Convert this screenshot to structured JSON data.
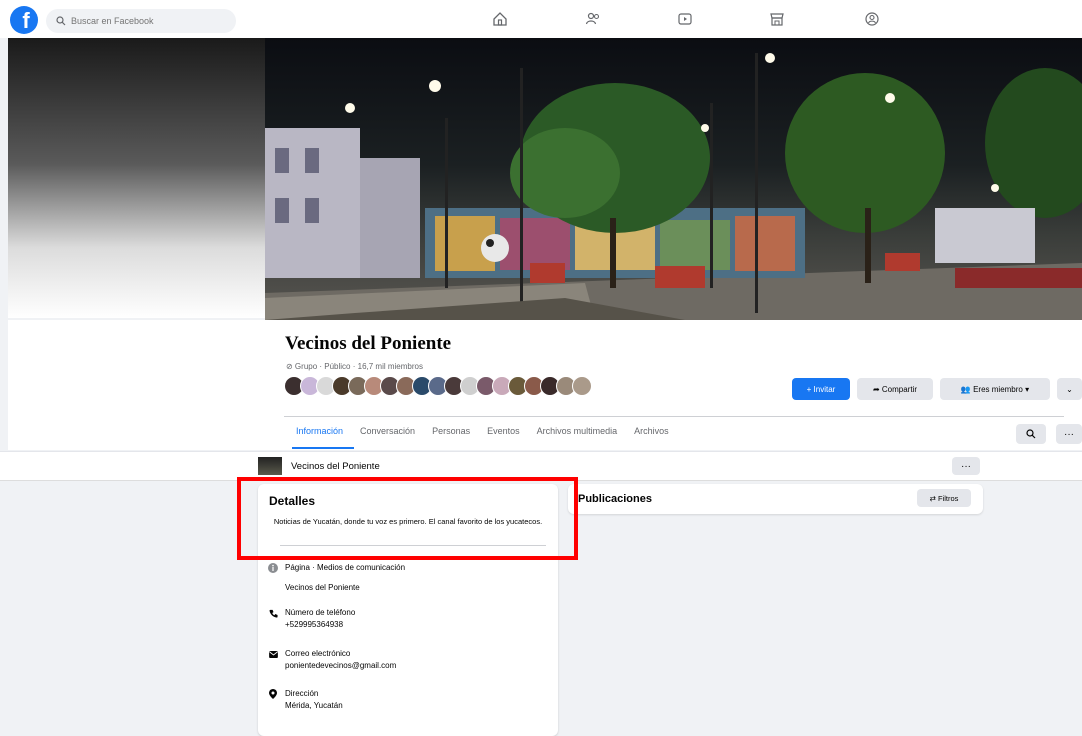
{
  "colors": {
    "brand": "#1877f2",
    "highlight": "#ff0000"
  },
  "topbar": {
    "logo_letter": "f",
    "search_placeholder": "Buscar en Facebook",
    "nav_icons": [
      "home-icon",
      "friends-icon",
      "watch-icon",
      "marketplace-icon",
      "groups-icon"
    ]
  },
  "group": {
    "name": "Vecinos del Poniente",
    "meta": "⊘ Grupo · Público · 16,7 mil miembros",
    "avatar_count": 19
  },
  "actions": {
    "invite": "+ Invitar",
    "share": "➦ Compartir",
    "member": "👥 Eres miembro ▾",
    "expand": "⌄"
  },
  "tabs": [
    "Información",
    "Conversación",
    "Personas",
    "Eventos",
    "Archivos multimedia",
    "Archivos"
  ],
  "sticky": {
    "name": "Vecinos del Poniente",
    "more": "···"
  },
  "details": {
    "title": "Detalles",
    "description": "Noticias de Yucatán, donde tu voz es primero. El canal favorito de los yucatecos.",
    "page_type": "Página · Medios de comunicación",
    "page_name": "Vecinos del Poniente",
    "phone_label": "Número de teléfono",
    "phone": "+529995364938",
    "email_label": "Correo electrónico",
    "email": "ponientedevecinos@gmail.com",
    "address_label": "Dirección",
    "address": "Mérida, Yucatán"
  },
  "posts": {
    "title": "Publicaciones",
    "filters": "⇄ Filtros"
  },
  "search_button": "⌕",
  "more_button": "···"
}
